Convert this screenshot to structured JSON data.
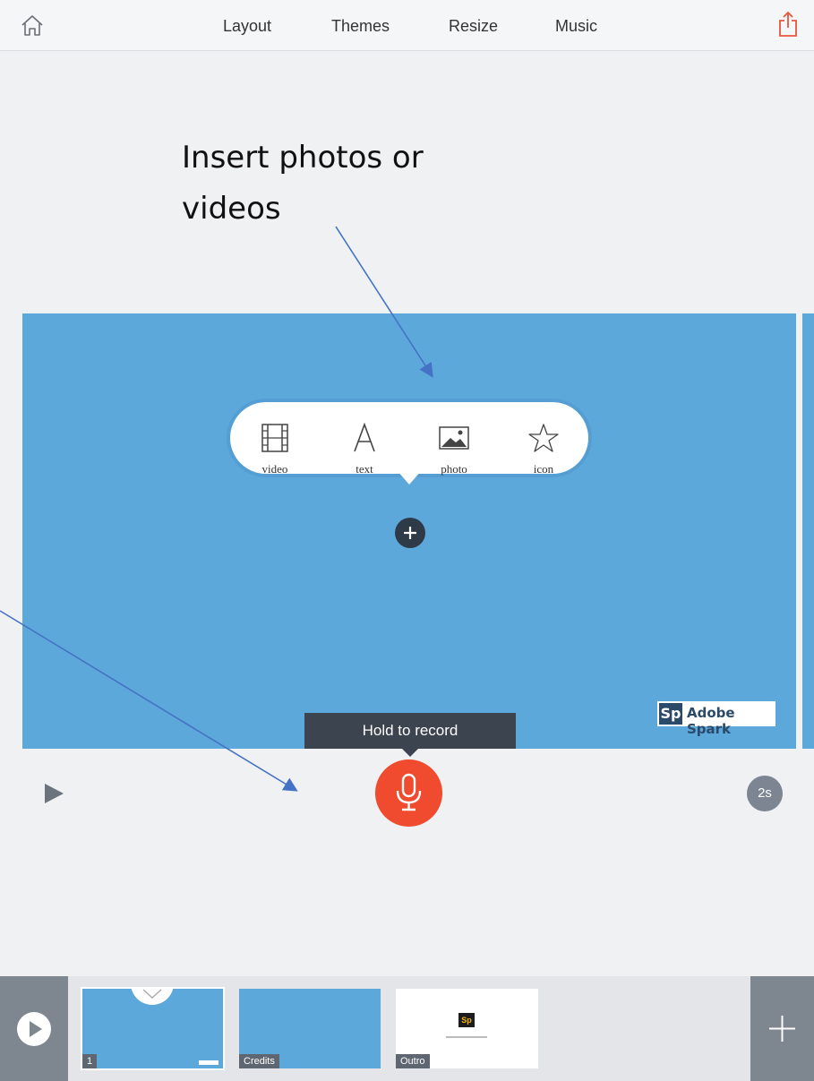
{
  "toolbar": {
    "nav": [
      "Layout",
      "Themes",
      "Resize",
      "Music"
    ]
  },
  "annotation": {
    "line1": "Insert photos or",
    "line2": "videos"
  },
  "slide": {
    "insert_options": [
      {
        "label": "video",
        "icon": "film-icon"
      },
      {
        "label": "text",
        "icon": "text-icon"
      },
      {
        "label": "photo",
        "icon": "image-icon"
      },
      {
        "label": "icon",
        "icon": "star-icon"
      }
    ],
    "brand_logo": "Sp",
    "brand_text": "Adobe Spark"
  },
  "recorder": {
    "tooltip": "Hold to record",
    "duration": "2s"
  },
  "filmstrip": {
    "thumbs": [
      {
        "label": "1"
      },
      {
        "label": "Credits"
      },
      {
        "label": "Outro"
      }
    ],
    "outro_logo": "Sp"
  },
  "colors": {
    "slide": "#5ca8db",
    "record": "#f04a2f",
    "share_icon": "#e8553e",
    "arrow": "#4472c4"
  }
}
